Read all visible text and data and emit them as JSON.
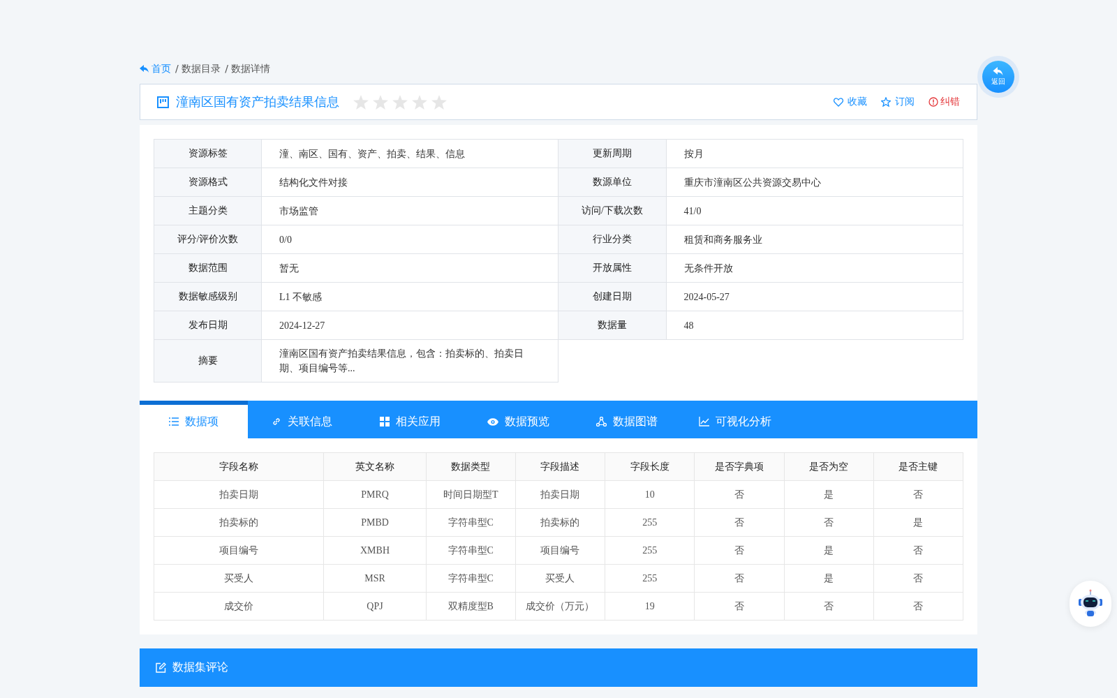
{
  "breadcrumb": [
    {
      "label": "首页",
      "link": true
    },
    {
      "label": "/ 数据目录",
      "link": false
    },
    {
      "label": "/ 数据详情",
      "link": false
    }
  ],
  "header": {
    "title": "潼南区国有资产拍卖结果信息",
    "stars": 0,
    "actions": [
      {
        "label": "收藏",
        "kind": "heart"
      },
      {
        "label": "订阅",
        "kind": "star"
      },
      {
        "label": "纠错",
        "kind": "alert"
      }
    ]
  },
  "back_button": {
    "label": "返回"
  },
  "info": [
    {
      "label": "资源标签",
      "value": "潼、南区、国有、资产、拍卖、结果、信息"
    },
    {
      "label": "更新周期",
      "value": "按月"
    },
    {
      "label": "资源格式",
      "value": "结构化文件对接"
    },
    {
      "label": "数源单位",
      "value": "重庆市潼南区公共资源交易中心"
    },
    {
      "label": "主题分类",
      "value": "市场监管"
    },
    {
      "label": "访问/下载次数",
      "value": "41/0"
    },
    {
      "label": "评分/评价次数",
      "value": "0/0"
    },
    {
      "label": "行业分类",
      "value": "租赁和商务服务业"
    },
    {
      "label": "数据范围",
      "value": "暂无"
    },
    {
      "label": "开放属性",
      "value": "无条件开放"
    },
    {
      "label": "数据敏感级别",
      "value": "L1 不敏感"
    },
    {
      "label": "创建日期",
      "value": "2024-05-27"
    },
    {
      "label": "发布日期",
      "value": "2024-12-27"
    },
    {
      "label": "数据量",
      "value": "48"
    },
    {
      "label": "摘要",
      "value": "潼南区国有资产拍卖结果信息，包含：拍卖标的、拍卖日期、项目编号等..."
    }
  ],
  "tabs": [
    {
      "label": "数据项",
      "selected": true
    },
    {
      "label": "关联信息",
      "selected": false
    },
    {
      "label": "相关应用",
      "selected": false
    },
    {
      "label": "数据预览",
      "selected": false
    },
    {
      "label": "数据图谱",
      "selected": false
    },
    {
      "label": "可视化分析",
      "selected": false
    }
  ],
  "table": {
    "columns": [
      "字段名称",
      "英文名称",
      "数据类型",
      "字段描述",
      "字段长度",
      "是否字典项",
      "是否为空",
      "是否主键"
    ],
    "rows": [
      [
        "拍卖日期",
        "PMRQ",
        "时间日期型T",
        "拍卖日期",
        "10",
        "否",
        "是",
        "否"
      ],
      [
        "拍卖标的",
        "PMBD",
        "字符串型C",
        "拍卖标的",
        "255",
        "否",
        "否",
        "是"
      ],
      [
        "项目编号",
        "XMBH",
        "字符串型C",
        "项目编号",
        "255",
        "否",
        "是",
        "否"
      ],
      [
        "买受人",
        "MSR",
        "字符串型C",
        "买受人",
        "255",
        "否",
        "是",
        "否"
      ],
      [
        "成交价",
        "QPJ",
        "双精度型B",
        "成交价（万元）",
        "19",
        "否",
        "否",
        "否"
      ]
    ]
  },
  "comments": {
    "title": "数据集评论"
  }
}
